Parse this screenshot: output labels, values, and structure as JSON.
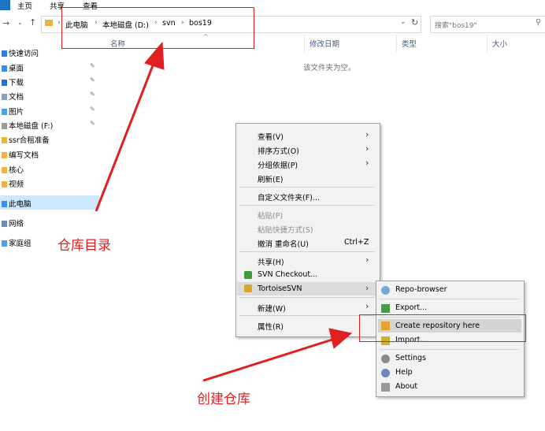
{
  "ribbon": {
    "tabs": [
      "主页",
      "共享",
      "查看"
    ]
  },
  "address": {
    "crumbs": [
      "此电脑",
      "本地磁盘 (D:)",
      "svn",
      "bos19"
    ],
    "search_placeholder": "搜索\"bos19\""
  },
  "columns": {
    "name": "名称",
    "date": "修改日期",
    "type": "类型",
    "size": "大小"
  },
  "empty_message": "该文件夹为空。",
  "sidebar": {
    "quick_access": "快速访问",
    "items": [
      "桌面",
      "下载",
      "文档",
      "图片",
      "本地磁盘 (F:)",
      "ssr合租准备",
      "编写文档",
      "核心",
      "视频"
    ],
    "this_pc": "此电脑",
    "network": "网络",
    "homegroup": "家庭组"
  },
  "context_menu": {
    "items": [
      "查看(V)",
      "排序方式(O)",
      "分组依据(P)",
      "刷新(E)",
      "自定义文件夹(F)...",
      "粘贴(P)",
      "粘贴快捷方式(S)",
      "撤消 重命名(U)",
      "共享(H)",
      "SVN Checkout...",
      "TortoiseSVN",
      "新建(W)",
      "属性(R)"
    ],
    "undo_shortcut": "Ctrl+Z"
  },
  "svn_submenu": {
    "items": [
      "Repo-browser",
      "Export...",
      "Create repository here",
      "Import...",
      "Settings",
      "Help",
      "About"
    ]
  },
  "annotations": {
    "repo_dir": "仓库目录",
    "create_repo": "创建仓库"
  },
  "colors": {
    "annotation": "#e02020",
    "selection": "#cce8ff",
    "folder": "#e8b540"
  }
}
